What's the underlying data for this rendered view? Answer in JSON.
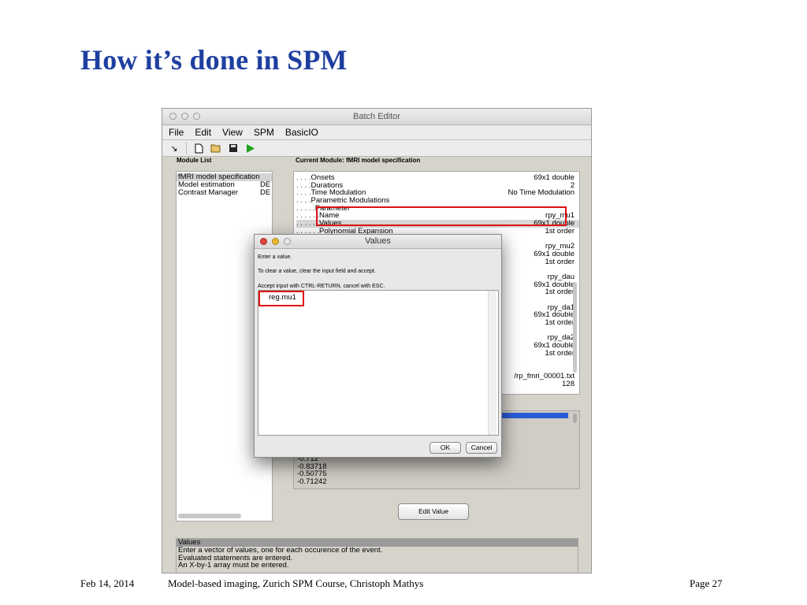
{
  "slide": {
    "title": "How it’s done in SPM",
    "footer": {
      "date": "Feb 14, 2014",
      "course": "Model-based imaging,    Zurich SPM Course,    Christoph Mathys",
      "page": "Page 27"
    }
  },
  "batch_editor": {
    "title": "Batch Editor",
    "menu": [
      "File",
      "Edit",
      "View",
      "SPM",
      "BasicIO"
    ],
    "toolbar_icons": [
      "arrow-icon",
      "new-file-icon",
      "open-folder-icon",
      "save-icon",
      "run-icon"
    ],
    "module_list_label": "Module List",
    "current_module_label": "Current Module: fMRI model specification",
    "modules": [
      {
        "name": "fMRI model specification",
        "status": ""
      },
      {
        "name": "Model estimation",
        "status": "DE"
      },
      {
        "name": "Contrast Manager",
        "status": "DE"
      }
    ],
    "tree": [
      {
        "dots": ". . . .",
        "label": "Onsets",
        "value": "69x1 double"
      },
      {
        "dots": ". . . .",
        "label": "Durations",
        "value": "2"
      },
      {
        "dots": ". . . .",
        "label": "Time Modulation",
        "value": "No Time Modulation"
      },
      {
        "dots": ". . . .",
        "label": "Parametric Modulations",
        "value": ""
      },
      {
        "dots": ". . . . .",
        "label": "Parameter",
        "value": ""
      },
      {
        "dots": ". . . . . .",
        "label": "Name",
        "value": "rpy_mu1"
      },
      {
        "dots": ". . . . . .",
        "label": "Values",
        "value": "69x1 double"
      },
      {
        "dots": ". . . . . .",
        "label": "Polynomial Expansion",
        "value": "1st order"
      },
      {
        "dots": "",
        "label": "",
        "value": ""
      },
      {
        "dots": "",
        "label": "",
        "value": "rpy_mu2"
      },
      {
        "dots": "",
        "label": "",
        "value": "69x1 double"
      },
      {
        "dots": "",
        "label": "",
        "value": "1st order"
      },
      {
        "dots": "",
        "label": "",
        "value": ""
      },
      {
        "dots": "",
        "label": "",
        "value": "rpy_dau"
      },
      {
        "dots": "",
        "label": "",
        "value": "69x1 double"
      },
      {
        "dots": "",
        "label": "",
        "value": "1st order"
      },
      {
        "dots": "",
        "label": "",
        "value": ""
      },
      {
        "dots": "",
        "label": "",
        "value": "rpy_da1"
      },
      {
        "dots": "",
        "label": "",
        "value": "69x1 double"
      },
      {
        "dots": "",
        "label": "",
        "value": "1st order"
      },
      {
        "dots": "",
        "label": "",
        "value": ""
      },
      {
        "dots": "",
        "label": "",
        "value": "rpy_da2"
      },
      {
        "dots": "",
        "label": "",
        "value": "69x1 double"
      },
      {
        "dots": "",
        "label": "",
        "value": "1st order"
      },
      {
        "dots": "",
        "label": "",
        "value": ""
      },
      {
        "dots": "",
        "label": "",
        "value": ""
      },
      {
        "dots": "",
        "label": "",
        "value": "/rp_fmri_00001.txt"
      },
      {
        "dots": "",
        "label": "",
        "value": "128"
      }
    ],
    "value_list": [
      "-0.712",
      "-0.83718",
      "-0.50775",
      "-0.71242"
    ],
    "edit_value_label": "Edit Value",
    "help": {
      "header": "Values",
      "lines": [
        "Enter a vector of values, one for each occurence of the event.",
        "Evaluated statements are entered.",
        "An X-by-1 array must be entered."
      ]
    }
  },
  "values_dialog": {
    "title": "Values",
    "line1": "Enter a value.",
    "line2": "To clear a value, clear the input field and accept.",
    "line3": "Accept input with CTRL-RETURN, cancel with ESC.",
    "input_value": "reg.mu1",
    "ok_label": "OK",
    "cancel_label": "Cancel"
  },
  "colors": {
    "title": "#1f3fa0",
    "highlight": "#e01010",
    "selection": "#2a5bd7"
  }
}
